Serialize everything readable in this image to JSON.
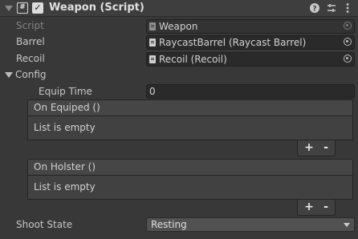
{
  "component": {
    "title": "Weapon (Script)",
    "script_icon": "#",
    "enabled_check": "✓",
    "header_icons": [
      "help-icon",
      "preset-icon",
      "more-options-icon"
    ]
  },
  "fields": {
    "script": {
      "label": "Script",
      "value": "Weapon"
    },
    "barrel": {
      "label": "Barrel",
      "value": "RaycastBarrel (Raycast Barrel)"
    },
    "recoil": {
      "label": "Recoil",
      "value": "Recoil (Recoil)"
    }
  },
  "config": {
    "label": "Config",
    "equip_time": {
      "label": "Equip Time",
      "value": "0"
    },
    "on_equiped": {
      "header": "On Equiped ()",
      "body": "List is empty",
      "add": "+",
      "remove": "-"
    },
    "on_holster": {
      "header": "On Holster ()",
      "body": "List is empty",
      "add": "+",
      "remove": "-"
    }
  },
  "shoot_state": {
    "label": "Shoot State",
    "value": "Resting"
  }
}
